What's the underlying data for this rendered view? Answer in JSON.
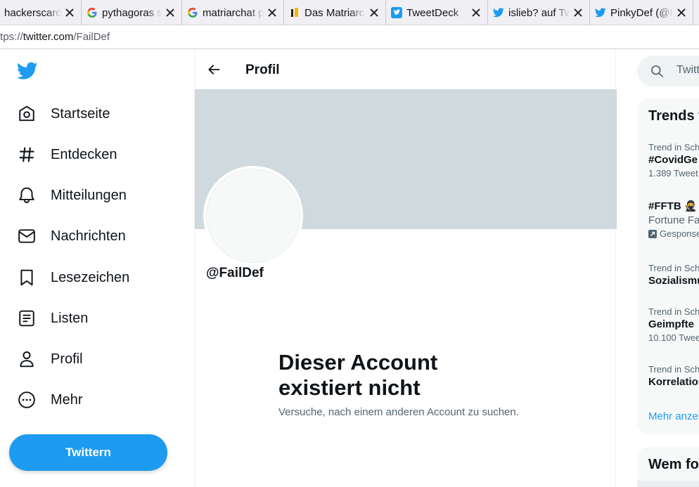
{
  "browser": {
    "tabs": [
      {
        "title": "hackerscardg",
        "favicon": "blank"
      },
      {
        "title": "pythagoras s",
        "favicon": "google-icon"
      },
      {
        "title": "matriarchat p",
        "favicon": "google-icon"
      },
      {
        "title": "Das Matriarc",
        "favicon": "site-icon"
      },
      {
        "title": "TweetDeck",
        "favicon": "tweetdeck-icon"
      },
      {
        "title": "islieb? auf Tw",
        "favicon": "twitter-bird-icon"
      },
      {
        "title": "PinkyDef (@F",
        "favicon": "twitter-bird-icon"
      }
    ],
    "url_scheme": "ttps://",
    "url_host": "twitter.com",
    "url_path": "/FailDef"
  },
  "nav": {
    "items": [
      {
        "label": "Startseite",
        "icon": "home-icon"
      },
      {
        "label": "Entdecken",
        "icon": "hashtag-icon"
      },
      {
        "label": "Mitteilungen",
        "icon": "bell-icon"
      },
      {
        "label": "Nachrichten",
        "icon": "envelope-icon"
      },
      {
        "label": "Lesezeichen",
        "icon": "bookmark-icon"
      },
      {
        "label": "Listen",
        "icon": "list-icon"
      },
      {
        "label": "Profil",
        "icon": "person-icon"
      },
      {
        "label": "Mehr",
        "icon": "more-circle-icon"
      }
    ],
    "tweet_button": "Twittern"
  },
  "main": {
    "header_title": "Profil",
    "handle": "@FailDef",
    "empty_title": "Dieser Account existiert nicht",
    "empty_subtitle": "Versuche, nach einem anderen Account zu suchen."
  },
  "sidebar": {
    "search_placeholder": "Twitt",
    "trends_title": "Trends f",
    "trends": [
      {
        "context": "Trend in Sch",
        "name": "#CovidGe",
        "meta": "1.389 Tweet"
      },
      {
        "context": "",
        "name": "#FFTB 🥷",
        "promo": "Fortune Fa",
        "meta": "Gesponse"
      },
      {
        "context": "Trend in Sch",
        "name": "Sozialismu",
        "meta": ""
      },
      {
        "context": "Trend in Sch",
        "name": "Geimpfte",
        "meta": "10.100 Twee"
      },
      {
        "context": "Trend in Sch",
        "name": "Korrelation",
        "meta": ""
      }
    ],
    "more_link": "Mehr anzei",
    "who_to_follow_title": "Wem fo"
  },
  "colors": {
    "accent": "#1d9bf0",
    "banner": "#cfd9de",
    "text": "#0f1419",
    "secondary_text": "#536471"
  }
}
